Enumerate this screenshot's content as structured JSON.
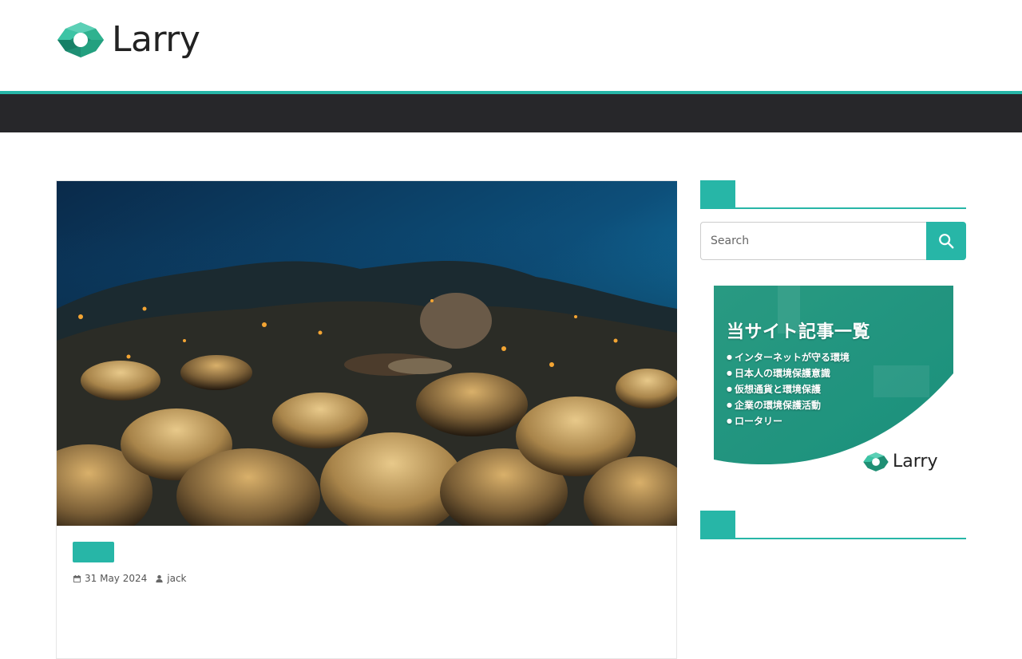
{
  "site": {
    "logo_text": "Larry",
    "accent_color": "#27b6a7",
    "nav_color": "#27272a"
  },
  "article": {
    "image_alt": "coral reef with sea turtle underwater",
    "category": "",
    "date": "31 May 2024",
    "author": "jack",
    "date_icon": "calendar-icon",
    "author_icon": "user-icon"
  },
  "sidebar": {
    "search": {
      "placeholder": "Search",
      "button_icon": "search-icon"
    },
    "banner": {
      "title": "当サイト記事一覧",
      "items": [
        "インターネットが守る環境",
        "日本人の環境保護意識",
        "仮想通貨と環境保護",
        "企業の環境保護活動",
        "ロータリー"
      ],
      "logo_text": "Larry"
    }
  }
}
